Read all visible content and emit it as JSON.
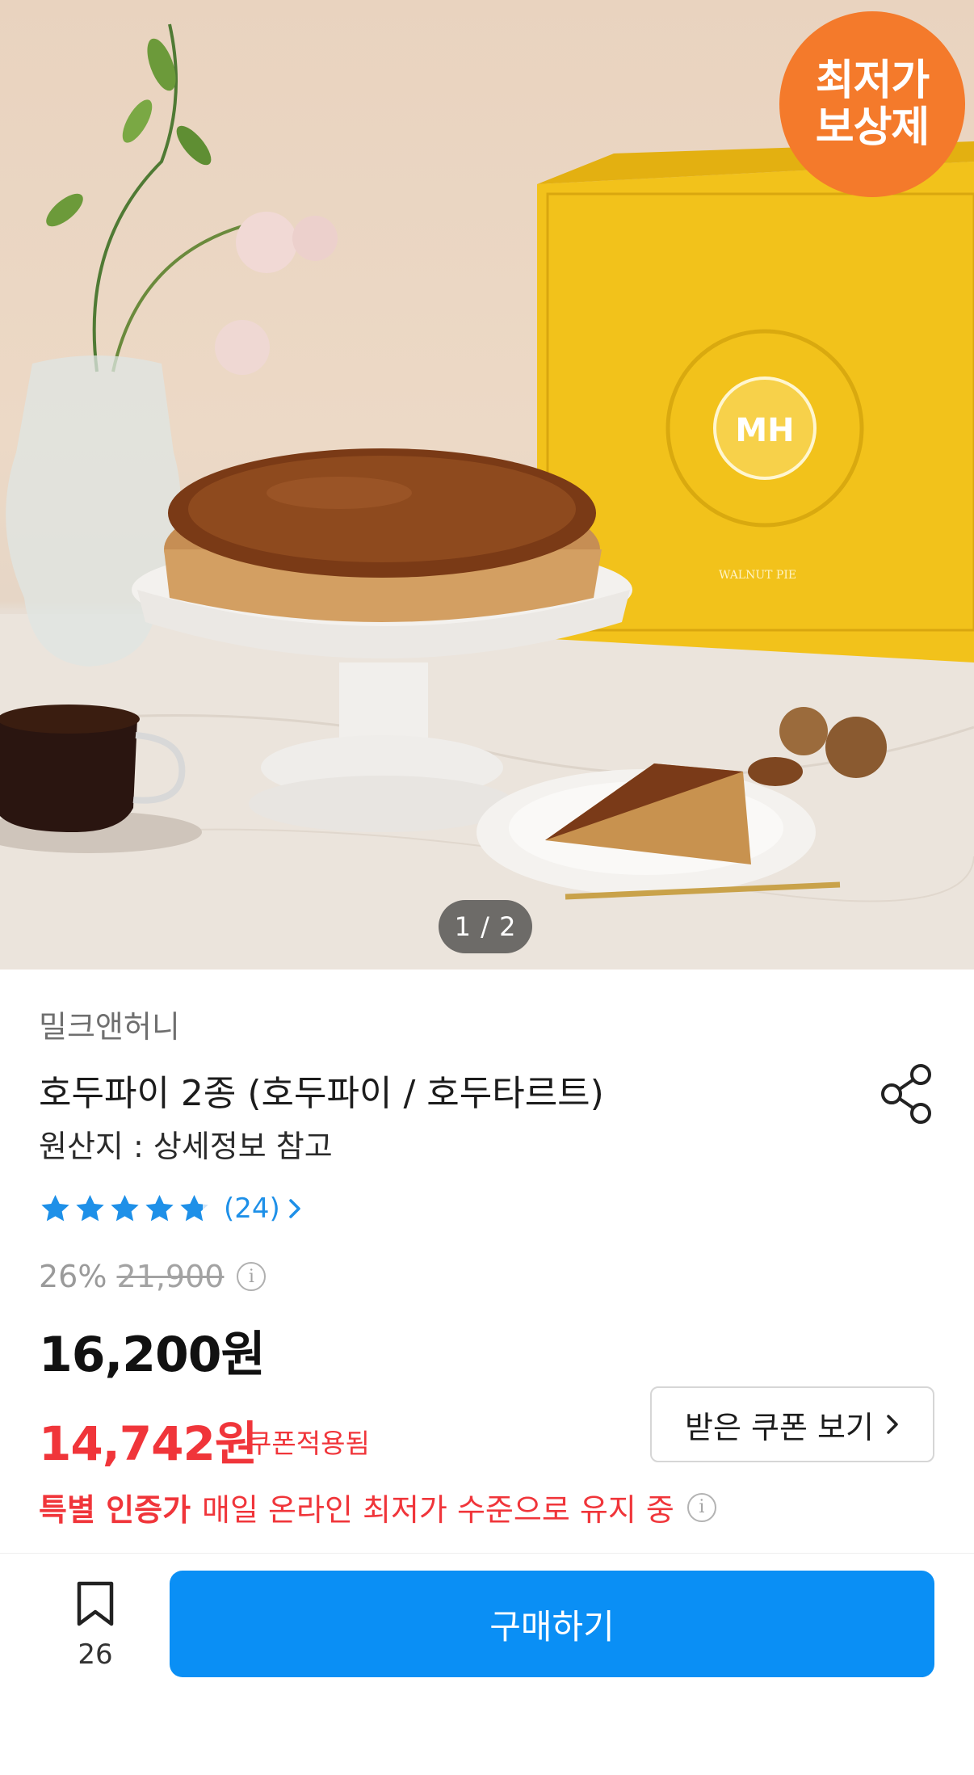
{
  "hero": {
    "badge_line1": "최저가",
    "badge_line2": "보상제",
    "pager": "1 / 2",
    "box_logo": "MH",
    "box_label": "WALNUT PIE"
  },
  "product": {
    "brand": "밀크앤허니",
    "title": "호두파이 2종 (호두파이 / 호두타르트)",
    "origin": "원산지 : 상세정보 참고",
    "rating": 4.8,
    "review_count": "(24)",
    "discount_rate": "26%",
    "original_price": "21,900",
    "price": "16,200원",
    "coupon_price": "14,742원",
    "coupon_applied_text": "쿠폰적용됨",
    "coupon_button_label": "받은 쿠폰 보기",
    "special_label": "특별 인증가",
    "special_text": "매일 온라인 최저가 수준으로 유지 중"
  },
  "bottom_bar": {
    "bookmark_count": "26",
    "buy_label": "구매하기"
  },
  "colors": {
    "accent_blue": "#0a8ff5",
    "price_red": "#f0353a",
    "badge_orange": "#f47a2b",
    "star_blue": "#1e90e8"
  },
  "icons": [
    "share-icon",
    "star-icon",
    "chevron-right-icon",
    "info-icon",
    "bookmark-icon"
  ]
}
